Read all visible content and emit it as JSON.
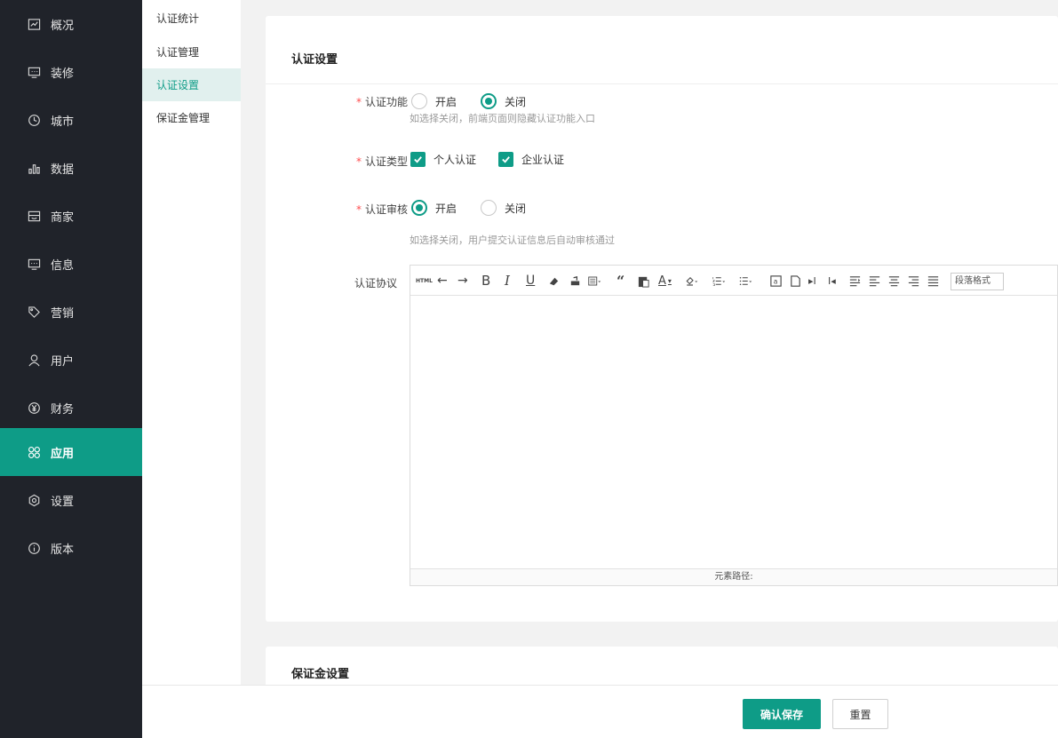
{
  "sidebar": {
    "items": [
      {
        "label": "概况",
        "icon": "overview-icon"
      },
      {
        "label": "装修",
        "icon": "decoration-icon"
      },
      {
        "label": "城市",
        "icon": "city-icon"
      },
      {
        "label": "数据",
        "icon": "data-chart-icon"
      },
      {
        "label": "商家",
        "icon": "merchant-icon"
      },
      {
        "label": "信息",
        "icon": "message-icon"
      },
      {
        "label": "营销",
        "icon": "tag-icon"
      },
      {
        "label": "用户",
        "icon": "user-icon"
      },
      {
        "label": "财务",
        "icon": "yuan-icon"
      },
      {
        "label": "应用",
        "icon": "apps-icon",
        "active": true
      },
      {
        "label": "设置",
        "icon": "gear-icon"
      },
      {
        "label": "版本",
        "icon": "info-icon"
      }
    ]
  },
  "submenu": {
    "items": [
      {
        "label": "认证统计"
      },
      {
        "label": "认证管理"
      },
      {
        "label": "认证设置",
        "active": true
      },
      {
        "label": "保证金管理"
      }
    ]
  },
  "certification": {
    "title": "认证设置",
    "function": {
      "label": "认证功能",
      "options": [
        "开启",
        "关闭"
      ],
      "selected": "关闭",
      "hint": "如选择关闭，前端页面则隐藏认证功能入口"
    },
    "type": {
      "label": "认证类型",
      "options": [
        "个人认证",
        "企业认证"
      ],
      "checked": [
        "个人认证",
        "企业认证"
      ]
    },
    "review": {
      "label": "认证审核",
      "options": [
        "开启",
        "关闭"
      ],
      "selected": "开启",
      "hint": "如选择关闭，用户提交认证信息后自动审核通过"
    },
    "agreement": {
      "label": "认证协议",
      "toolbar_html": "HTML",
      "paragraph_format": "段落格式",
      "status_path": "元素路径:"
    }
  },
  "deposit": {
    "title": "保证金设置"
  },
  "footer": {
    "save_label": "确认保存",
    "reset_label": "重置"
  },
  "colors": {
    "accent": "#0e9c87",
    "sidebar_bg": "#20232a",
    "required": "#ff4d4f"
  }
}
